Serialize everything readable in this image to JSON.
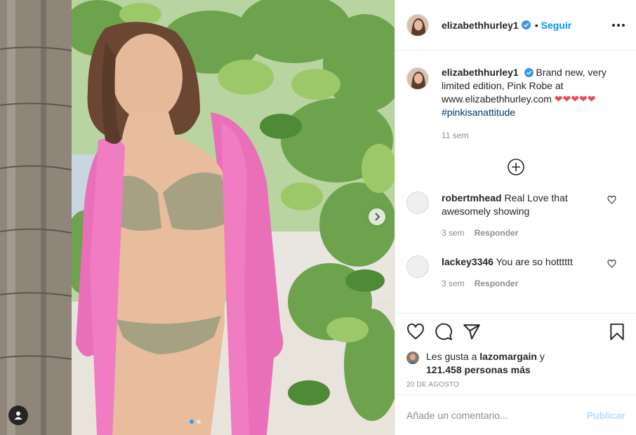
{
  "post": {
    "username": "elizabethhurley1",
    "separator": "•",
    "follow_label": "Seguir",
    "caption": {
      "username": "elizabethhurley1",
      "text": "Brand new, very limited edition, Pink Robe at www.elizabethhurley.com",
      "emoji": "❤❤❤❤❤",
      "hashtag": "#pinkisanattitude",
      "time": "11 sem"
    },
    "comments": [
      {
        "username": "robertmhead",
        "text": "Real Love that awesomely showing",
        "time": "3 sem",
        "reply_label": "Responder"
      },
      {
        "username": "lackey3346",
        "text": "You are so hotttttt",
        "time": "3 sem",
        "reply_label": "Responder"
      }
    ],
    "likes": {
      "prefix": "Les gusta a",
      "user": "lazomargain",
      "joiner": "y",
      "count": "121.458 personas más"
    },
    "date": "20 DE AGOSTO",
    "add_comment": {
      "placeholder": "Añade un comentario...",
      "publish_label": "Publicar"
    },
    "carousel": {
      "count": 2,
      "active": 1
    }
  },
  "icons": {
    "verified": "verified-badge-icon",
    "more": "more-options-icon",
    "load_more": "plus-circle-icon",
    "like": "heart-icon",
    "comment": "comment-bubble-icon",
    "share": "paper-plane-icon",
    "save": "bookmark-icon",
    "next": "chevron-right-icon",
    "tag": "user-tag-icon"
  },
  "colors": {
    "accent": "#0095f6",
    "verified": "#3897f0",
    "robe": "#e96fb8",
    "hashtag": "#00376b"
  }
}
